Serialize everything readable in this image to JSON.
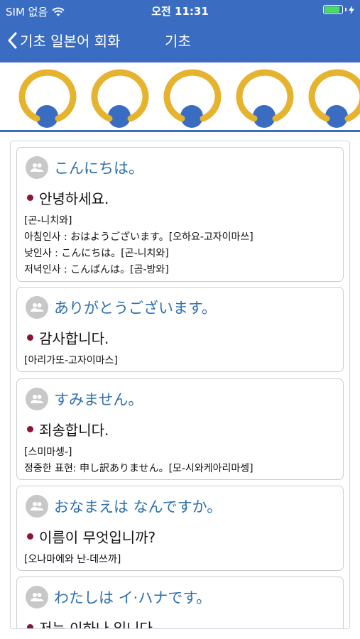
{
  "status": {
    "carrier": "SIM 없음",
    "time": "오전 11:31"
  },
  "nav": {
    "back_label": "기초 일본어 회화",
    "title": "기초"
  },
  "colors": {
    "nav_bg": "#3a6cc2",
    "ring": "#e5b32e",
    "japanese_text": "#2f6fae",
    "bullet": "#8a1538"
  },
  "phrases": [
    {
      "japanese": "こんにちは。",
      "korean": "안녕하세요.",
      "notes": [
        "[곤-니치와]",
        "아침인사 : おはようございます。[오하요-고자이마쓰]",
        "낮인사 : こんにちは。[곤-니치와]",
        "저녁인사 : こんばんは。[곰-방와]"
      ]
    },
    {
      "japanese": "ありがとうございます。",
      "korean": "감사합니다.",
      "notes": [
        "[아리가또-고자이마스]"
      ]
    },
    {
      "japanese": "すみません。",
      "korean": "죄송합니다.",
      "notes": [
        "[스미마셍-]",
        "정중한 표현: 申し訳ありません。[모-시와케아리마셍]"
      ]
    },
    {
      "japanese": "おなまえは なんですか。",
      "korean": "이름이 무엇입니까?",
      "notes": [
        "[오나마에와 난-데쓰까]"
      ]
    },
    {
      "japanese": "わたしは イ·ハナです。",
      "korean": "저는 이하나 입니다.",
      "notes": []
    }
  ]
}
